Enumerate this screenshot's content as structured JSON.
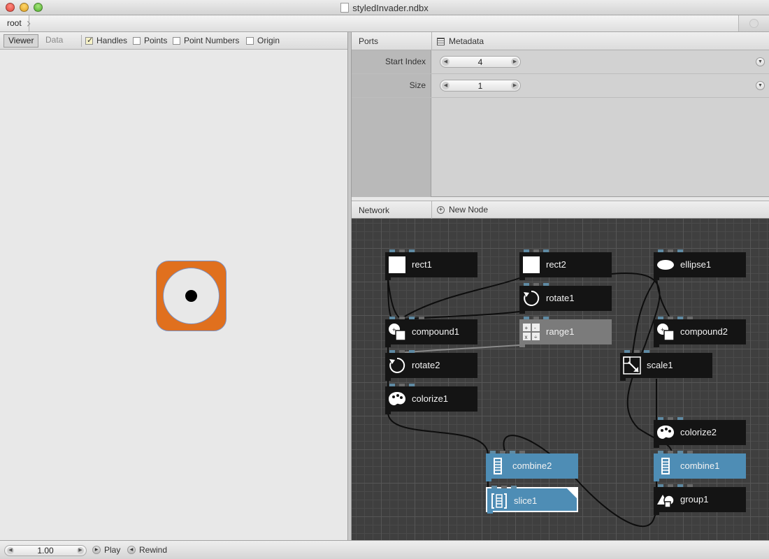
{
  "window": {
    "title": "styledInvader.ndbx"
  },
  "breadcrumb": {
    "root": "root"
  },
  "viewer": {
    "tabs": [
      "Viewer",
      "Data"
    ],
    "active_tab": "Viewer",
    "options": [
      {
        "label": "Handles",
        "checked": true
      },
      {
        "label": "Points",
        "checked": false
      },
      {
        "label": "Point Numbers",
        "checked": false
      },
      {
        "label": "Origin",
        "checked": false
      }
    ],
    "shape_colors": {
      "fill": "#e0701e",
      "stroke": "#7a8fc0"
    }
  },
  "ports": {
    "header": "Ports",
    "metadata_label": "Metadata",
    "rows": [
      {
        "name": "Start Index",
        "value": "4"
      },
      {
        "name": "Size",
        "value": "1"
      }
    ]
  },
  "network": {
    "header": "Network",
    "new_node_label": "New Node",
    "nodes": [
      {
        "id": "rect1",
        "label": "rect1",
        "icon": "rect-icon",
        "style": "dark"
      },
      {
        "id": "rect2",
        "label": "rect2",
        "icon": "rect-icon",
        "style": "dark"
      },
      {
        "id": "ellipse1",
        "label": "ellipse1",
        "icon": "ellipse-icon",
        "style": "dark"
      },
      {
        "id": "rotate1",
        "label": "rotate1",
        "icon": "rotate-icon",
        "style": "dark"
      },
      {
        "id": "compound1",
        "label": "compound1",
        "icon": "compound-icon",
        "style": "dark"
      },
      {
        "id": "range1",
        "label": "range1",
        "icon": "range-icon",
        "style": "grey"
      },
      {
        "id": "compound2",
        "label": "compound2",
        "icon": "compound-icon",
        "style": "dark"
      },
      {
        "id": "rotate2",
        "label": "rotate2",
        "icon": "rotate-icon",
        "style": "dark"
      },
      {
        "id": "scale1",
        "label": "scale1",
        "icon": "scale-icon",
        "style": "dark"
      },
      {
        "id": "colorize1",
        "label": "colorize1",
        "icon": "palette-icon",
        "style": "dark"
      },
      {
        "id": "colorize2",
        "label": "colorize2",
        "icon": "palette-icon",
        "style": "dark"
      },
      {
        "id": "combine2",
        "label": "combine2",
        "icon": "combine-icon",
        "style": "blue"
      },
      {
        "id": "combine1",
        "label": "combine1",
        "icon": "combine-icon",
        "style": "blue"
      },
      {
        "id": "slice1",
        "label": "slice1",
        "icon": "slice-icon",
        "style": "blue-selected"
      },
      {
        "id": "group1",
        "label": "group1",
        "icon": "group-icon",
        "style": "dark"
      }
    ],
    "colors": {
      "background": "#3f3f3f",
      "node": "#141414",
      "rendered_node": "#4e8db5",
      "port": "#5f8aa3"
    }
  },
  "transport": {
    "frame": "1.00",
    "play_label": "Play",
    "rewind_label": "Rewind"
  }
}
